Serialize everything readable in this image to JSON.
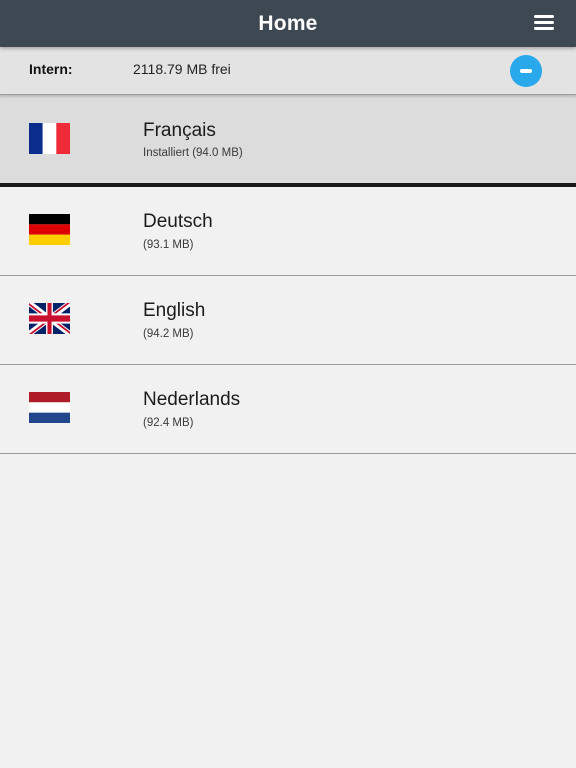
{
  "header": {
    "title": "Home",
    "menu_icon": "hamburger-menu-icon",
    "background_color": "#3d4852"
  },
  "storage": {
    "label": "Intern:",
    "value": "2118.79 MB frei",
    "collapse_icon": "minus-icon",
    "accent_color": "#29a9ec"
  },
  "languages": [
    {
      "name": "Français",
      "size": "Installiert (94.0 MB)",
      "flag": "france-flag-icon",
      "installed": true
    },
    {
      "name": "Deutsch",
      "size": "(93.1 MB)",
      "flag": "germany-flag-icon",
      "installed": false
    },
    {
      "name": "English",
      "size": "(94.2 MB)",
      "flag": "uk-flag-icon",
      "installed": false
    },
    {
      "name": "Nederlands",
      "size": "(92.4 MB)",
      "flag": "netherlands-flag-icon",
      "installed": false
    }
  ]
}
